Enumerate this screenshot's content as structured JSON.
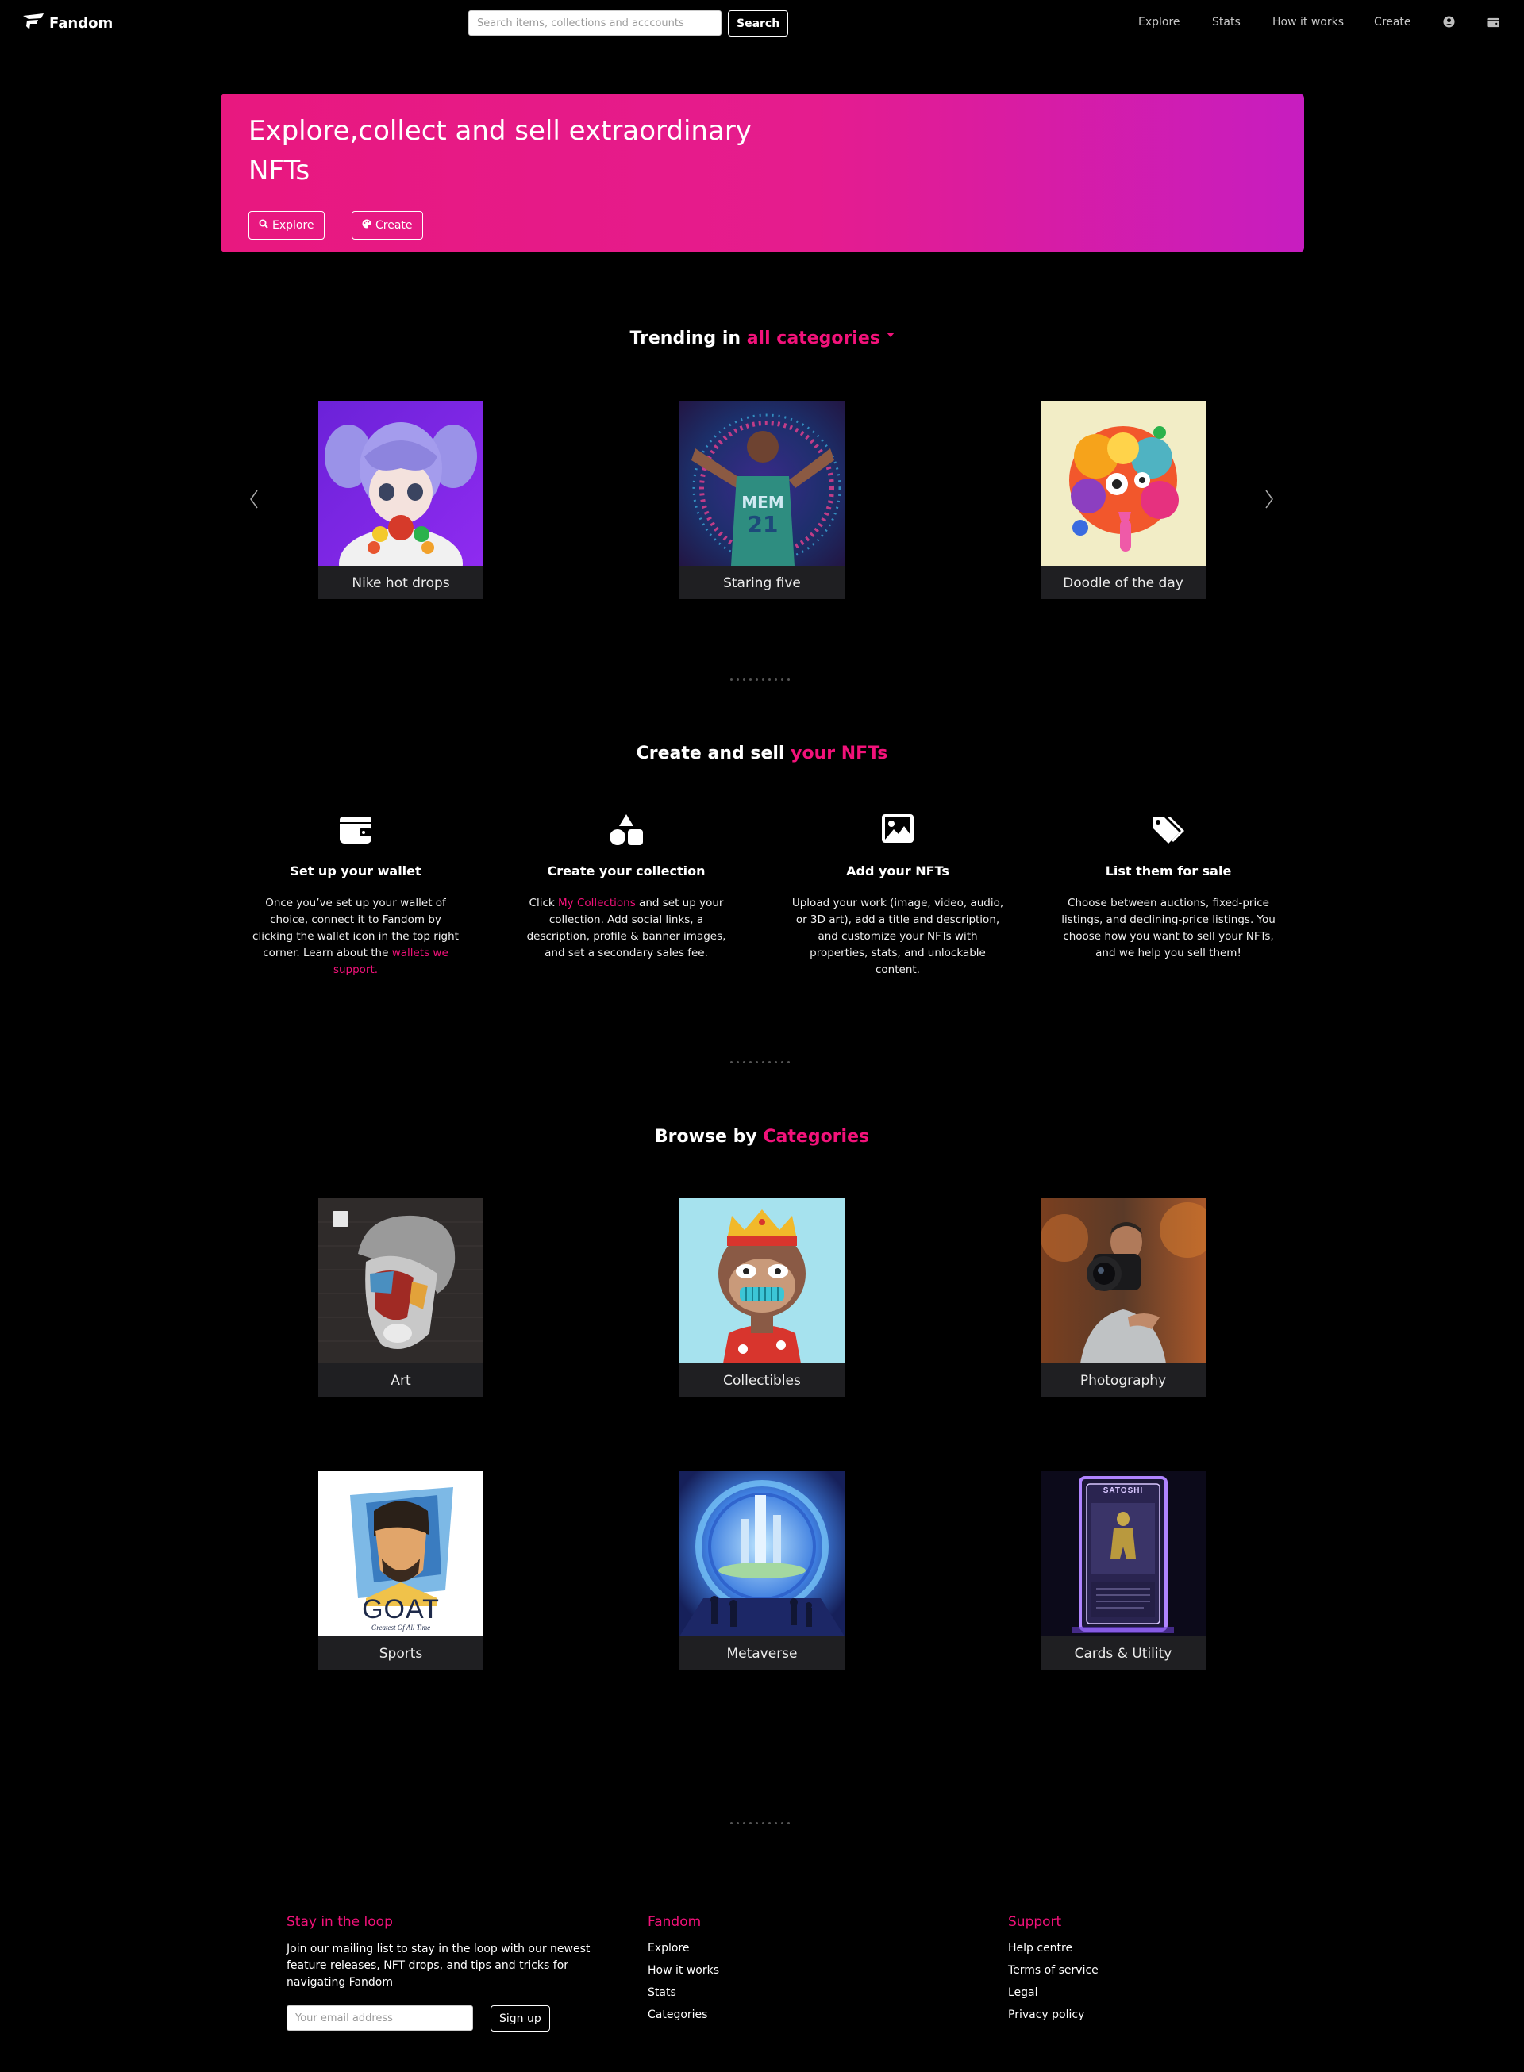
{
  "nav": {
    "brand": "Fandom",
    "search_placeholder": "Search items, collections and acccounts",
    "search_button": "Search",
    "links": [
      "Explore",
      "Stats",
      "How it works",
      "Create"
    ],
    "icons": [
      "account-icon",
      "wallet-icon"
    ]
  },
  "hero": {
    "title": "Explore,collect and sell extraordinary NFTs",
    "explore_button": "Explore",
    "create_button": "Create",
    "gradient": [
      "#e8187f",
      "#c71dc0"
    ]
  },
  "trending": {
    "prefix": "Trending in ",
    "accent": "all categories",
    "items": [
      {
        "label": "Nike hot drops"
      },
      {
        "label": "Staring five"
      },
      {
        "label": "Doodle of the day"
      }
    ]
  },
  "create_sell": {
    "prefix": "Create and sell ",
    "accent": "your NFTs",
    "steps": [
      {
        "icon": "wallet-icon",
        "title": "Set up your wallet",
        "text_before": "Once you’ve set up your wallet of choice, connect it to Fandom by clicking the wallet icon in the top right corner. Learn about the ",
        "link": "wallets we support.",
        "text_after": ""
      },
      {
        "icon": "shapes-icon",
        "title": "Create your collection",
        "text_before": "Click ",
        "link": "My Collections",
        "text_after": " and set up your collection. Add social links, a description, profile & banner images, and set a secondary sales fee."
      },
      {
        "icon": "image-icon",
        "title": "Add your NFTs",
        "text_before": "Upload your work (image, video, audio, or 3D art), add a title and description, and customize your NFTs with properties, stats, and unlockable content.",
        "link": "",
        "text_after": ""
      },
      {
        "icon": "tags-icon",
        "title": "List them for sale",
        "text_before": "Choose between auctions, fixed-price listings, and declining-price listings. You choose how you want to sell your NFTs, and we help you sell them!",
        "link": "",
        "text_after": ""
      }
    ]
  },
  "browse": {
    "prefix": "Browse by ",
    "accent": "Categories",
    "categories": [
      {
        "label": "Art"
      },
      {
        "label": "Collectibles"
      },
      {
        "label": "Photography"
      },
      {
        "label": "Sports",
        "art_text": "GOAT",
        "art_subtext": "Greatest Of All Time"
      },
      {
        "label": "Metaverse"
      },
      {
        "label": "Cards & Utility",
        "art_text": "SATOSHI"
      }
    ]
  },
  "footer": {
    "loop": {
      "title": "Stay in the loop",
      "text": "Join our mailing list to stay in the loop with our newest feature releases, NFT drops, and tips and tricks for navigating Fandom",
      "email_placeholder": "Your email address",
      "signup_button": "Sign up"
    },
    "fandom": {
      "title": "Fandom",
      "links": [
        "Explore",
        "How it works",
        "Stats",
        "Categories"
      ]
    },
    "support": {
      "title": "Support",
      "links": [
        "Help centre",
        "Terms of service",
        "Legal",
        "Privacy policy"
      ]
    }
  },
  "colors": {
    "accent": "#f2127a",
    "background": "#000000",
    "card": "#1f1f22"
  }
}
